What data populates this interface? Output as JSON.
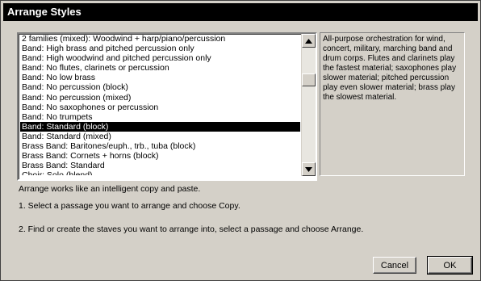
{
  "window": {
    "title": "Arrange Styles"
  },
  "styles_list": {
    "items": [
      "2 families (mixed): Woodwind + harp/piano/percussion",
      "Band: High brass and pitched percussion only",
      "Band: High woodwind and pitched percussion only",
      "Band: No flutes, clarinets or percussion",
      "Band: No low brass",
      "Band: No percussion (block)",
      "Band: No percussion (mixed)",
      "Band: No saxophones or percussion",
      "Band: No trumpets",
      "Band: Standard (block)",
      "Band: Standard (mixed)",
      "Brass Band: Baritones/euph., trb., tuba (block)",
      "Brass Band: Cornets + horns (block)",
      "Brass Band: Standard"
    ],
    "selected_item": "Band: Standard (block)",
    "partial_item": "Choir: Solo (blend)"
  },
  "description": "All-purpose orchestration for wind, concert, military, marching band and drum corps. Flutes and clarinets play the fastest material; saxophones play slower material; pitched percussion play even slower material; brass play the slowest material.",
  "instructions": {
    "line1": "Arrange works like an intelligent copy and paste.",
    "line2": "1. Select a passage you want to arrange and choose Copy.",
    "line3": "2. Find or create the staves you want to arrange into, select a passage and choose Arrange."
  },
  "buttons": {
    "cancel": "Cancel",
    "ok": "OK"
  },
  "icons": {
    "scroll_up": "triangle-up-icon",
    "scroll_down": "triangle-down-icon"
  }
}
